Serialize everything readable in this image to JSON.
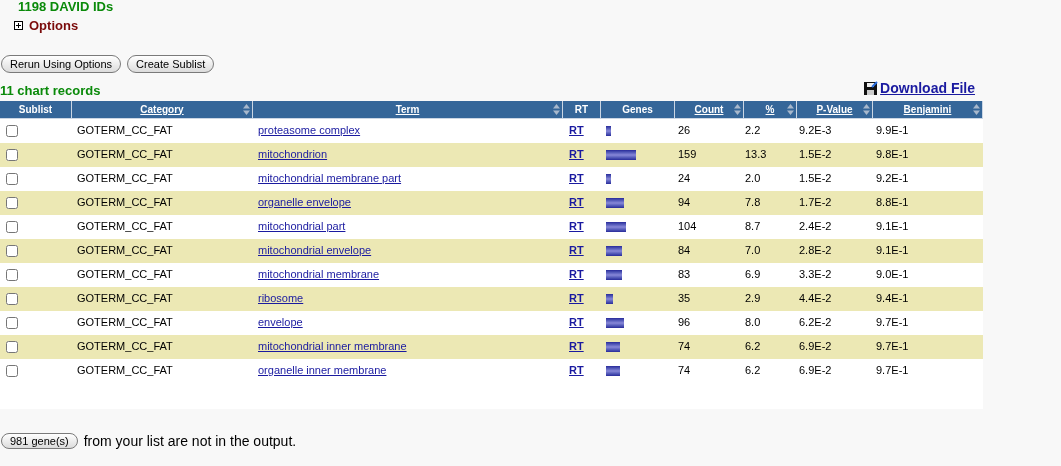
{
  "summary": {
    "ids_label": "1198 DAVID IDs",
    "options_label": "Options"
  },
  "buttons": [
    "Rerun Using Options",
    "Create Sublist"
  ],
  "records_label": "11 chart records",
  "download": {
    "label": "Download File"
  },
  "table": {
    "columns": [
      {
        "label": "Sublist",
        "sortable": false,
        "link": false
      },
      {
        "label": "Category",
        "sortable": true,
        "link": true
      },
      {
        "label": "Term",
        "sortable": true,
        "link": true
      },
      {
        "label": "RT",
        "sortable": false,
        "link": false
      },
      {
        "label": "Genes",
        "sortable": false,
        "link": false
      },
      {
        "label": "Count",
        "sortable": true,
        "link": true
      },
      {
        "label": "%",
        "sortable": true,
        "link": true
      },
      {
        "label": "P-Value",
        "sortable": true,
        "link": true
      },
      {
        "label": "Benjamini",
        "sortable": true,
        "link": true
      }
    ],
    "rows": [
      {
        "checked": false,
        "category": "GOTERM_CC_FAT",
        "term": "proteasome complex",
        "rt": "RT",
        "count": "26",
        "percent": "2.2",
        "pvalue": "9.2E-3",
        "benjamini": "9.9E-1"
      },
      {
        "checked": false,
        "category": "GOTERM_CC_FAT",
        "term": "mitochondrion",
        "rt": "RT",
        "count": "159",
        "percent": "13.3",
        "pvalue": "1.5E-2",
        "benjamini": "9.8E-1"
      },
      {
        "checked": false,
        "category": "GOTERM_CC_FAT",
        "term": "mitochondrial membrane part",
        "rt": "RT",
        "count": "24",
        "percent": "2.0",
        "pvalue": "1.5E-2",
        "benjamini": "9.2E-1"
      },
      {
        "checked": false,
        "category": "GOTERM_CC_FAT",
        "term": "organelle envelope",
        "rt": "RT",
        "count": "94",
        "percent": "7.8",
        "pvalue": "1.7E-2",
        "benjamini": "8.8E-1"
      },
      {
        "checked": false,
        "category": "GOTERM_CC_FAT",
        "term": "mitochondrial part",
        "rt": "RT",
        "count": "104",
        "percent": "8.7",
        "pvalue": "2.4E-2",
        "benjamini": "9.1E-1"
      },
      {
        "checked": false,
        "category": "GOTERM_CC_FAT",
        "term": "mitochondrial envelope",
        "rt": "RT",
        "count": "84",
        "percent": "7.0",
        "pvalue": "2.8E-2",
        "benjamini": "9.1E-1"
      },
      {
        "checked": false,
        "category": "GOTERM_CC_FAT",
        "term": "mitochondrial membrane",
        "rt": "RT",
        "count": "83",
        "percent": "6.9",
        "pvalue": "3.3E-2",
        "benjamini": "9.0E-1"
      },
      {
        "checked": false,
        "category": "GOTERM_CC_FAT",
        "term": "ribosome",
        "rt": "RT",
        "count": "35",
        "percent": "2.9",
        "pvalue": "4.4E-2",
        "benjamini": "9.4E-1"
      },
      {
        "checked": false,
        "category": "GOTERM_CC_FAT",
        "term": "envelope",
        "rt": "RT",
        "count": "96",
        "percent": "8.0",
        "pvalue": "6.2E-2",
        "benjamini": "9.7E-1"
      },
      {
        "checked": false,
        "category": "GOTERM_CC_FAT",
        "term": "mitochondrial inner membrane",
        "rt": "RT",
        "count": "74",
        "percent": "6.2",
        "pvalue": "6.9E-2",
        "benjamini": "9.7E-1"
      },
      {
        "checked": false,
        "category": "GOTERM_CC_FAT",
        "term": "organelle inner membrane",
        "rt": "RT",
        "count": "74",
        "percent": "6.2",
        "pvalue": "6.9E-2",
        "benjamini": "9.7E-1"
      }
    ]
  },
  "footer": {
    "button": "981 gene(s)",
    "text": "from your list are not in the output."
  }
}
